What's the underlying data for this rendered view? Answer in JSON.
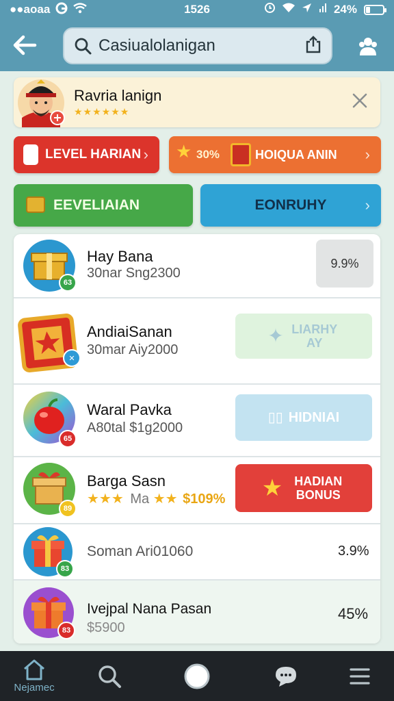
{
  "status_bar": {
    "carrier": "●●aoaa",
    "time": "1526",
    "battery": "24%",
    "battery_level": 0.24
  },
  "header": {
    "search_value": "Casiualolanigan",
    "icons": [
      "back-arrow-icon",
      "search-icon",
      "share-icon",
      "people-icon"
    ]
  },
  "player": {
    "name": "Ravria lanign",
    "stars": "★★★★★★"
  },
  "actions": {
    "level_label": "LEVEL HARIAN",
    "bonus_percent": "30%",
    "bonus_label": "HOIQUA ANIN",
    "event_label": "EEVELIAIAN",
    "history_label": "EONRUHY"
  },
  "rewards": [
    {
      "title": "Hay Bana",
      "subtitle": "30nar Sng2300",
      "badge": "63",
      "value": "9.9%"
    },
    {
      "title": "AndiaiSanan",
      "subtitle": "30mar Aiy2000",
      "action_label": "LIARHY AY"
    },
    {
      "title": "Waral Pavka",
      "subtitle": "A80tal $1g2000",
      "badge": "65",
      "action_label": "HIDNIAI"
    },
    {
      "title": "Barga Sasn",
      "stars": "★★★",
      "subtitle_text": "Ma",
      "mini_stars": "★★",
      "amount": "$109%",
      "badge": "89",
      "action_label": "HADIAN BONUS"
    },
    {
      "subtitle": "Soman Ari01060",
      "badge": "83",
      "value": "3.9%"
    },
    {
      "title": "Ivejpal Nana Pasan",
      "subtitle": "$5900",
      "badge": "83",
      "value": "45%"
    }
  ],
  "nav": {
    "home_label": "Nejamec"
  },
  "colors": {
    "header": "#5a9bb3",
    "level": "#dc342b",
    "bonus": "#ec7032",
    "event": "#46a848",
    "history": "#2fa3d5",
    "claim": "#e2403a"
  }
}
